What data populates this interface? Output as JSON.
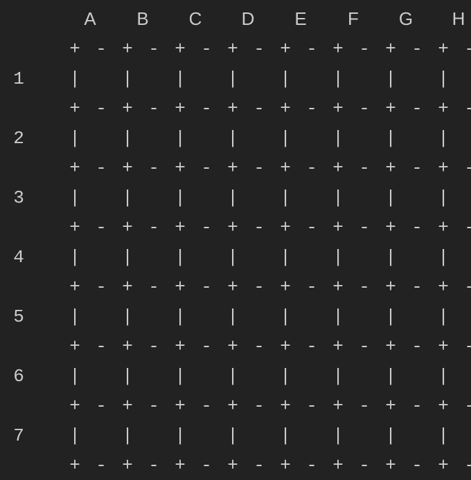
{
  "columns": [
    "A",
    "B",
    "C",
    "D",
    "E",
    "F",
    "G",
    "H"
  ],
  "rows": [
    "1",
    "2",
    "3",
    "4",
    "5",
    "6",
    "7"
  ],
  "glyphs": {
    "corner": "+",
    "hseg": "-",
    "vseg": "|"
  }
}
